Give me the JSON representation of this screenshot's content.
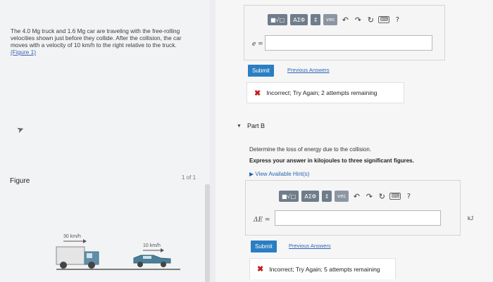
{
  "problem": {
    "line1": "The 4.0 Mg truck and 1.6 Mg car are traveling with the free-rolling",
    "line2": "velocities shown just before they collide. After the collision, the car",
    "line3": "moves with a velocity of 10 km/h to the right relative to the truck.",
    "figure_link": "(Figure 1)"
  },
  "figure": {
    "label": "Figure",
    "count": "1 of 1",
    "truck_speed": "30 km/h",
    "car_speed": "10 km/h",
    "truck_color": "#e7e7e7",
    "car_color": "#4a7f9a"
  },
  "toolbar": {
    "btn_sqrt": "■√□",
    "btn_greek": "AΣΦ",
    "btn_arrows": "↕",
    "btn_vec": "vec",
    "undo": "↶",
    "redo": "↷",
    "reset": "↻",
    "keyboard": "⌨",
    "help": "?"
  },
  "part_a": {
    "input_label": "e =",
    "submit": "Submit",
    "previous": "Previous Answers",
    "feedback": "Incorrect; Try Again; 2 attempts remaining"
  },
  "part_b": {
    "title": "Part B",
    "question": "Determine the loss of energy due to the collision.",
    "instruction": "Express your answer in kilojoules to three significant figures.",
    "hints": "View Available Hint(s)",
    "input_label": "ΔE =",
    "unit": "kJ",
    "submit": "Submit",
    "previous": "Previous Answers",
    "feedback": "Incorrect; Try Again; 5 attempts remaining"
  },
  "colors": {
    "accent": "#2a7ec2",
    "error": "#c01d1d",
    "link": "#2a64b2"
  }
}
